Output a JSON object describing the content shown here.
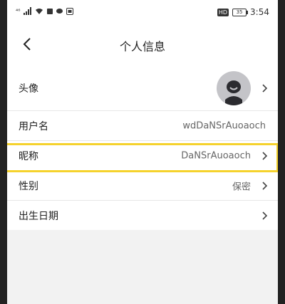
{
  "status_bar": {
    "carrier_text": "⁴⁶",
    "hd": "HD",
    "battery": "35",
    "time": "3:54"
  },
  "header": {
    "title": "个人信息",
    "back_icon": "chevron-left-icon"
  },
  "rows": [
    {
      "label": "头像",
      "value": "",
      "has_arrow": true,
      "icon": "avatar-icon"
    },
    {
      "label": "用户名",
      "value": "wdDaNSrAuoaoch",
      "has_arrow": false
    },
    {
      "label": "昵称",
      "value": "DaNSrAuoaoch",
      "has_arrow": true
    },
    {
      "label": "性别",
      "value": "保密",
      "has_arrow": true
    },
    {
      "label": "出生日期",
      "value": "",
      "has_arrow": true
    }
  ],
  "colors": {
    "highlight": "#f5d22c",
    "background": "#f2f2f2",
    "avatar_bg": "#c4c4c8"
  }
}
